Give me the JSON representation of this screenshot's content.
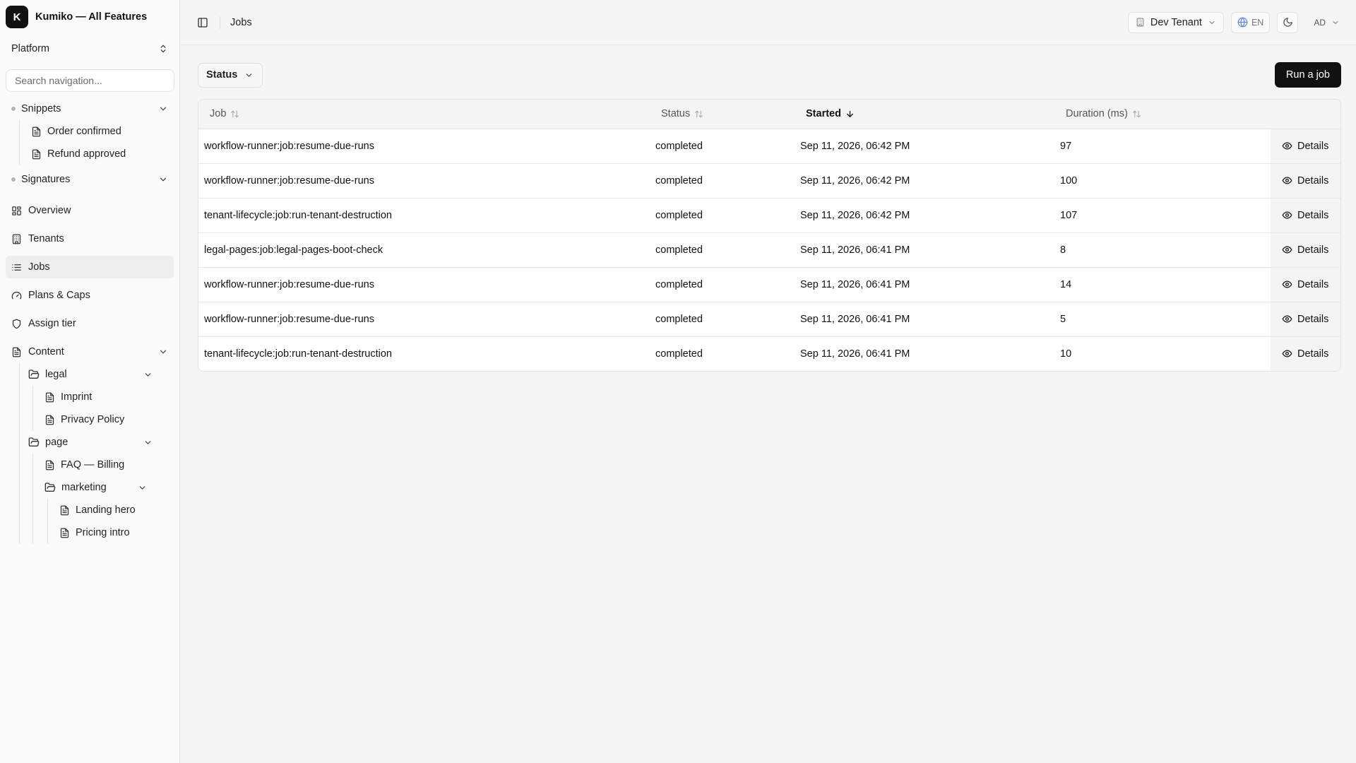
{
  "brand": {
    "logo_letter": "K",
    "name": "Kumiko — All Features"
  },
  "platform": {
    "label": "Platform"
  },
  "search": {
    "placeholder": "Search navigation..."
  },
  "sidebar": {
    "snippets": {
      "label": "Snippets",
      "items": [
        "Order confirmed",
        "Refund approved"
      ]
    },
    "signatures": {
      "label": "Signatures"
    },
    "nav": [
      {
        "label": "Overview",
        "icon": "dashboard-icon"
      },
      {
        "label": "Tenants",
        "icon": "building-icon"
      },
      {
        "label": "Jobs",
        "icon": "list-icon",
        "active": true
      },
      {
        "label": "Plans & Caps",
        "icon": "gauge-icon"
      },
      {
        "label": "Assign tier",
        "icon": "shield-icon"
      }
    ],
    "content": {
      "label": "Content",
      "legal": {
        "label": "legal",
        "items": [
          "Imprint",
          "Privacy Policy"
        ]
      },
      "page": {
        "label": "page",
        "items": [
          "FAQ — Billing"
        ],
        "marketing": {
          "label": "marketing",
          "items": [
            "Landing hero",
            "Pricing intro"
          ]
        }
      }
    }
  },
  "topbar": {
    "breadcrumb": "Jobs",
    "tenant": "Dev Tenant",
    "lang": "EN",
    "user_initials": "AD"
  },
  "toolbar": {
    "status_filter": "Status",
    "run_button": "Run a job"
  },
  "table": {
    "headers": {
      "job": "Job",
      "status": "Status",
      "started": "Started",
      "duration": "Duration (ms)"
    },
    "action_label": "Details",
    "rows": [
      {
        "job": "workflow-runner:job:resume-due-runs",
        "status": "completed",
        "started": "Sep 11, 2026, 06:42 PM",
        "duration": "97"
      },
      {
        "job": "workflow-runner:job:resume-due-runs",
        "status": "completed",
        "started": "Sep 11, 2026, 06:42 PM",
        "duration": "100"
      },
      {
        "job": "tenant-lifecycle:job:run-tenant-destruction",
        "status": "completed",
        "started": "Sep 11, 2026, 06:42 PM",
        "duration": "107"
      },
      {
        "job": "legal-pages:job:legal-pages-boot-check",
        "status": "completed",
        "started": "Sep 11, 2026, 06:41 PM",
        "duration": "8"
      },
      {
        "job": "workflow-runner:job:resume-due-runs",
        "status": "completed",
        "started": "Sep 11, 2026, 06:41 PM",
        "duration": "14"
      },
      {
        "job": "workflow-runner:job:resume-due-runs",
        "status": "completed",
        "started": "Sep 11, 2026, 06:41 PM",
        "duration": "5"
      },
      {
        "job": "tenant-lifecycle:job:run-tenant-destruction",
        "status": "completed",
        "started": "Sep 11, 2026, 06:41 PM",
        "duration": "10"
      }
    ]
  }
}
